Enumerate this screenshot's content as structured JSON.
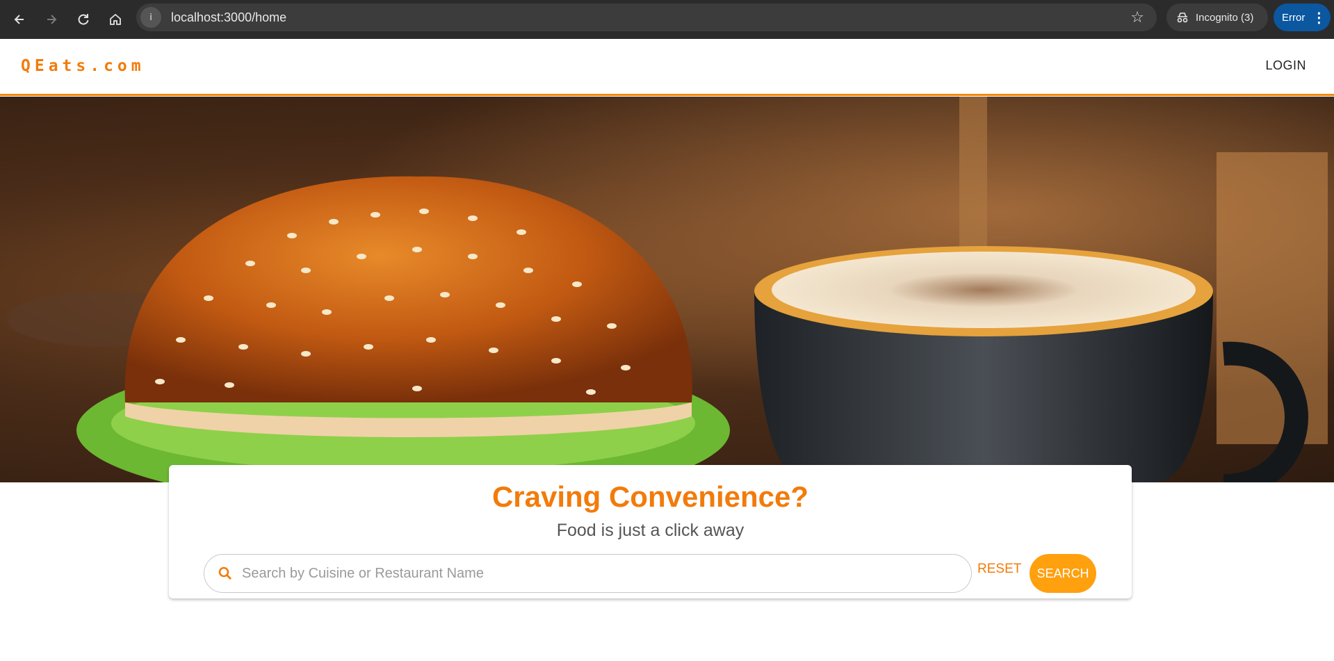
{
  "browser": {
    "url": "localhost:3000/home",
    "incognito_label": "Incognito (3)",
    "error_label": "Error"
  },
  "header": {
    "brand": "QEats.com",
    "login_label": "LOGIN"
  },
  "hero": {
    "title": "Craving Convenience?",
    "subtitle": "Food is just a click away"
  },
  "search": {
    "placeholder": "Search by Cuisine or Restaurant Name",
    "value": "",
    "reset_label": "RESET",
    "search_label": "SEARCH"
  },
  "colors": {
    "brand": "#f27b0b",
    "search_button": "#ffa00f",
    "chrome_bg": "#2b2b2b",
    "error_pill": "#0b57a0"
  }
}
